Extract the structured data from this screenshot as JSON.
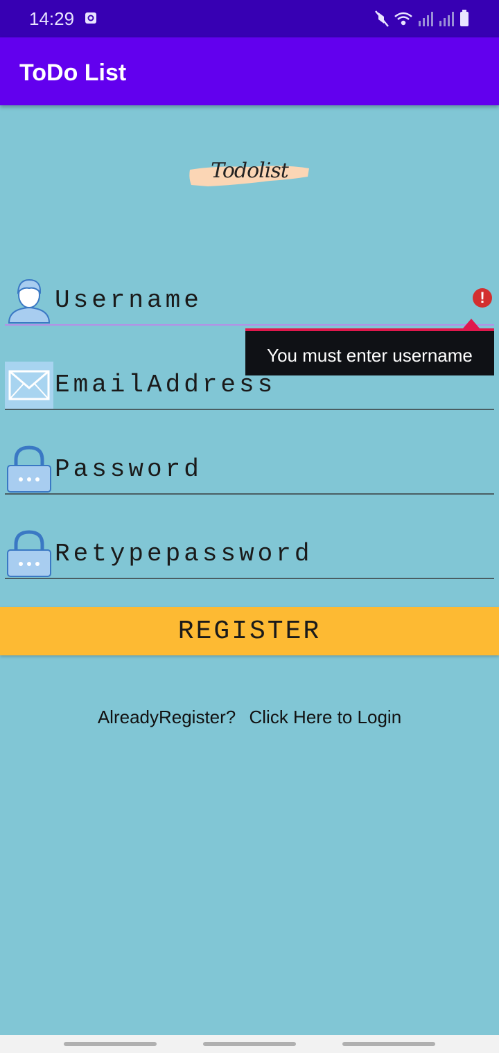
{
  "status_bar": {
    "time": "14:29",
    "icons": [
      "alarm-icon",
      "mute-icon",
      "wifi-icon",
      "signal-icon",
      "signal-icon",
      "battery-icon"
    ]
  },
  "app_bar": {
    "title": "ToDo List"
  },
  "logo": {
    "text": "Todolist",
    "brush_color": "#fbd6b5"
  },
  "form": {
    "username": {
      "placeholder": "Username",
      "icon": "user-icon",
      "error_icon": "error-icon"
    },
    "email": {
      "placeholder": "EmailAddress",
      "icon": "envelope-icon"
    },
    "password": {
      "placeholder": "Password",
      "icon": "lock-icon"
    },
    "retype_password": {
      "placeholder": "Retypepassword",
      "icon": "lock-icon"
    },
    "error_tooltip": "You must enter username"
  },
  "register_button": {
    "label": "REGISTER"
  },
  "login_prompt": {
    "question": "AlreadyRegister?",
    "link": "Click Here to Login"
  },
  "colors": {
    "background": "#81c6d5",
    "status_bar": "#3700b3",
    "app_bar": "#6200ee",
    "register_button": "#fdba33",
    "error": "#d32f2f"
  }
}
